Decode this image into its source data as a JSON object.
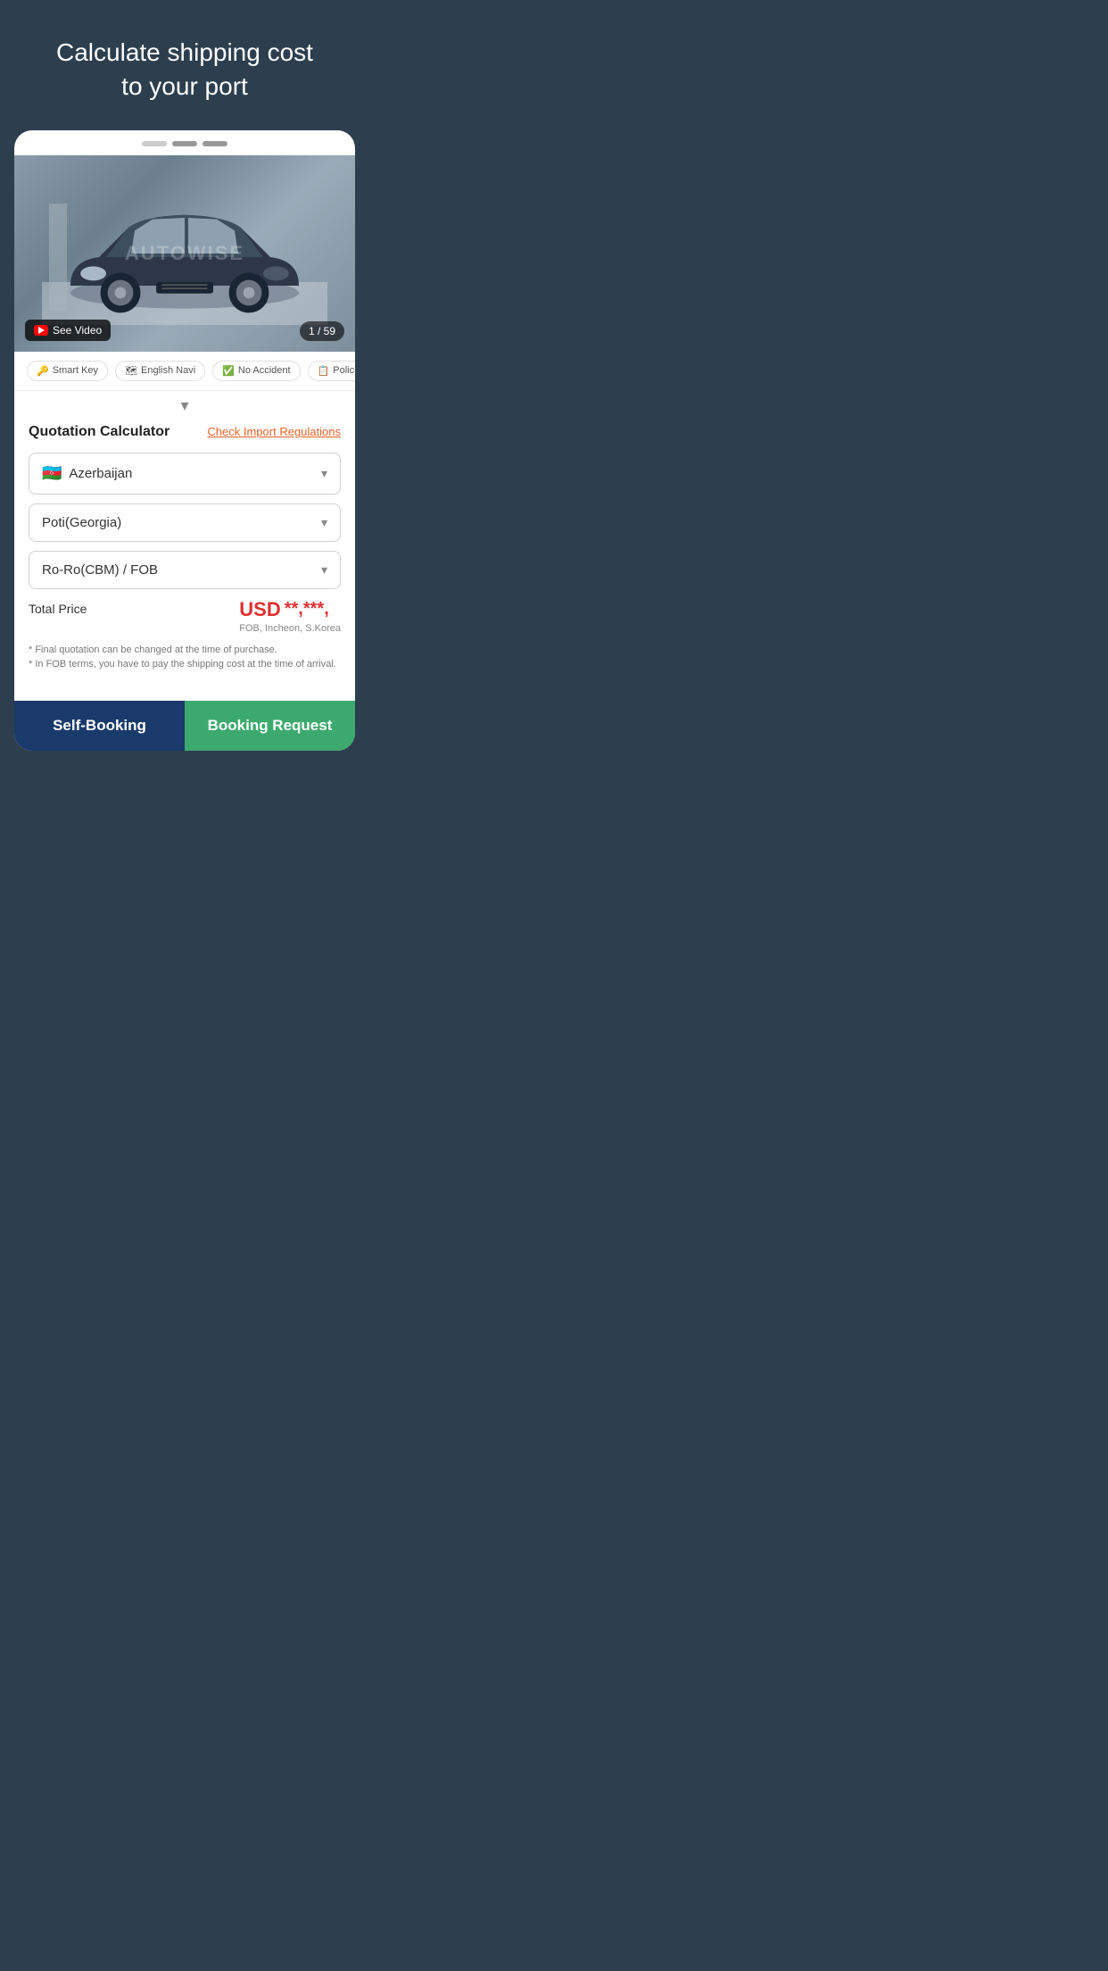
{
  "hero": {
    "title": "Calculate shipping cost\nto your port"
  },
  "carousel": {
    "dots": [
      {
        "active": false
      },
      {
        "active": true
      },
      {
        "active": true
      }
    ]
  },
  "car_image": {
    "watermark": "AUTOWISE",
    "see_video_label": "See Video",
    "counter": "1 / 59"
  },
  "feature_tags": [
    {
      "label": "Smart Key",
      "icon": "🔑"
    },
    {
      "label": "English Navi",
      "icon": "🗺"
    },
    {
      "label": "No Accident",
      "icon": "✅"
    },
    {
      "label": "Polic...",
      "icon": "📋"
    }
  ],
  "chevron_label": "▾",
  "quotation": {
    "title": "Quotation Calculator",
    "check_import_label": "Check Import Regulations",
    "country_label": "Azerbaijan",
    "country_flag": "🇦🇿",
    "port_label": "Poti(Georgia)",
    "shipping_label": "Ro-Ro(CBM) / FOB",
    "total_price_label": "Total Price",
    "price_currency": "USD",
    "price_asterisks": "**,***,",
    "fob_info": "FOB, Incheon, S.Korea",
    "disclaimer_lines": [
      "* Final quotation can be changed at the time of purchase.",
      "* In FOB terms, you have to pay the shipping cost at the time of arrival."
    ]
  },
  "buttons": {
    "self_booking_label": "Self-Booking",
    "booking_request_label": "Booking Request"
  }
}
